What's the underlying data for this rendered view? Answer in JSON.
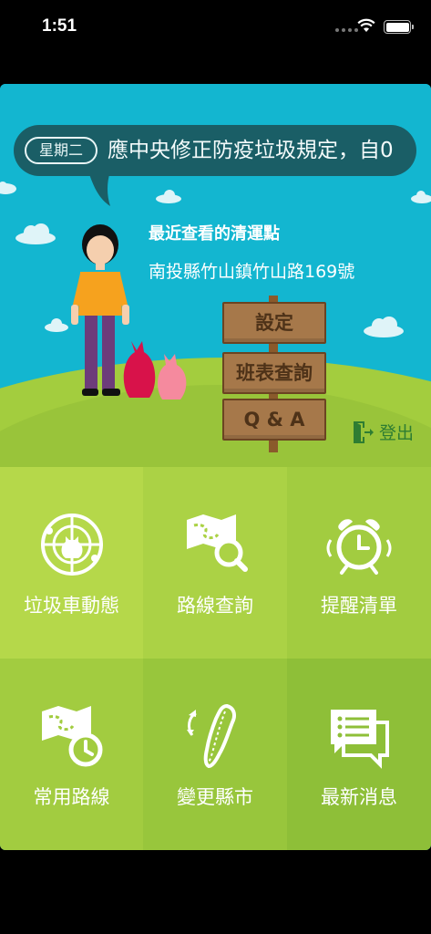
{
  "status_bar": {
    "time": "1:51"
  },
  "marquee": {
    "weekday": "星期二",
    "text": "應中央修正防疫垃圾規定，自0"
  },
  "recent": {
    "title": "最近查看的清運點",
    "address": "南投縣竹山鎮竹山路169號"
  },
  "signs": {
    "settings": "設定",
    "schedule": "班表查詢",
    "qa": "Q & A"
  },
  "logout_label": "登出",
  "menu": [
    {
      "label": "垃圾車動態",
      "icon": "garbage-truck-radar-icon"
    },
    {
      "label": "路線查詢",
      "icon": "route-search-icon"
    },
    {
      "label": "提醒清單",
      "icon": "alarm-clock-icon"
    },
    {
      "label": "常用路線",
      "icon": "frequent-route-icon"
    },
    {
      "label": "變更縣市",
      "icon": "taiwan-map-icon"
    },
    {
      "label": "最新消息",
      "icon": "news-chat-icon"
    }
  ],
  "colors": {
    "sky": "#13b6d0",
    "grass": "#a3cd3e",
    "bubble": "#1a5e66",
    "sign_wood": "#a6784a",
    "logout": "#2e7d32"
  }
}
